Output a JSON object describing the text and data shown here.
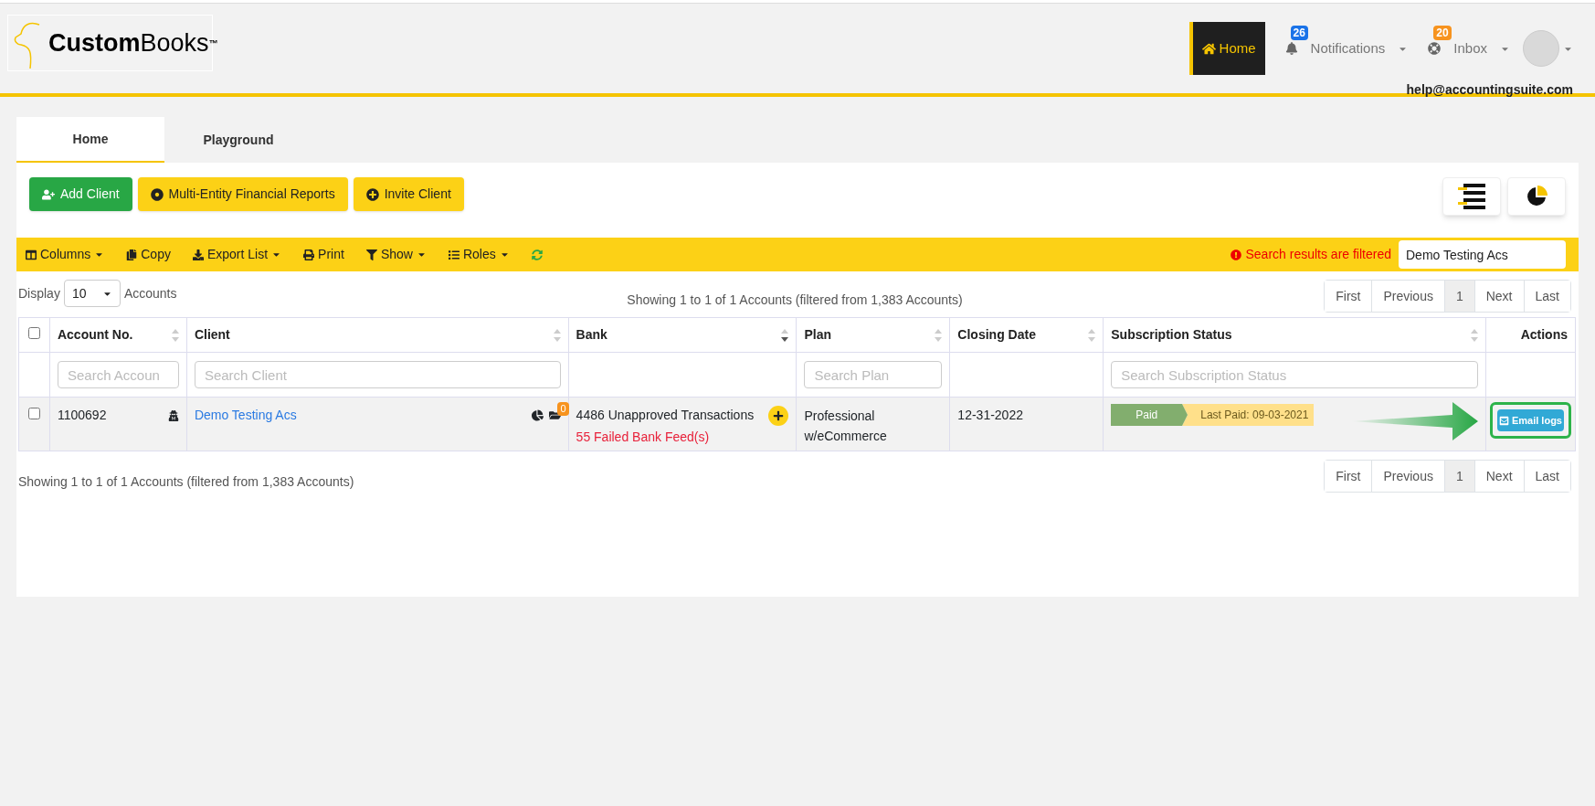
{
  "header": {
    "logo": {
      "bold": "Custom",
      "light": "Books",
      "mark": "™"
    },
    "nav": [
      {
        "kind": "home",
        "label": "Home",
        "selected": true
      },
      {
        "kind": "notifications",
        "label": "Notifications",
        "badge": "26"
      },
      {
        "kind": "inbox",
        "label": "Inbox",
        "badge": "20"
      }
    ],
    "user_email": "help@accountingsuite.com"
  },
  "tabs": [
    {
      "label": "Home",
      "selected": true
    },
    {
      "label": "Playground",
      "selected": false
    }
  ],
  "action_buttons": [
    {
      "kind": "add",
      "label": "Add Client",
      "color": "#28a745"
    },
    {
      "kind": "reports",
      "label": "Multi-Entity Financial Reports",
      "color": "#fcd116"
    },
    {
      "kind": "invite",
      "label": "Invite Client",
      "color": "#fcd116"
    }
  ],
  "toolbar": {
    "items": [
      {
        "kind": "columns",
        "label": "Columns",
        "dropdown": true
      },
      {
        "kind": "copy",
        "label": "Copy",
        "dropdown": false
      },
      {
        "kind": "export",
        "label": "Export List",
        "dropdown": true
      },
      {
        "kind": "print",
        "label": "Print",
        "dropdown": false
      },
      {
        "kind": "show",
        "label": "Show",
        "dropdown": true
      },
      {
        "kind": "roles",
        "label": "Roles",
        "dropdown": true
      }
    ],
    "filter_notice": "Search results are filtered",
    "search_value": "Demo Testing Acs"
  },
  "display": {
    "label": "Display",
    "value": "10",
    "suffix": "Accounts"
  },
  "info_top": "Showing 1 to 1 of 1 Accounts (filtered from 1,383 Accounts)",
  "pagination_top": [
    {
      "label": "First",
      "selected": false
    },
    {
      "label": "Previous",
      "selected": false
    },
    {
      "label": "1",
      "selected": true
    },
    {
      "label": "Next",
      "selected": false
    },
    {
      "label": "Last",
      "selected": false
    }
  ],
  "table": {
    "select_all": {
      "checked": false
    },
    "columns": [
      {
        "label": "Account No.",
        "sortable": true,
        "sorted": false,
        "placeholder": "Search Accoun"
      },
      {
        "label": "Client",
        "sortable": true,
        "sorted": false,
        "placeholder": "Search Client"
      },
      {
        "label": "Bank",
        "sortable": true,
        "sorted": true
      },
      {
        "label": "Plan",
        "sortable": true,
        "sorted": false,
        "placeholder": "Search Plan"
      },
      {
        "label": "Closing Date",
        "sortable": true,
        "sorted": false
      },
      {
        "label": "Subscription Status",
        "sortable": true,
        "sorted": false,
        "placeholder": "Search Subscription Status"
      },
      {
        "label": "Actions",
        "sortable": false
      }
    ],
    "rows": [
      {
        "checked": false,
        "account_no": "1100692",
        "client": "Demo Testing Acs",
        "client_badge": "0",
        "bank_info": "4486 Unapproved Transactions",
        "bank_alert": "55 Failed Bank Feed(s)",
        "plan": "Professional w/eCommerce",
        "closing_date": "12-31-2022",
        "status": "Paid",
        "last_paid": "Last Paid: 09-03-2021",
        "action": "Email logs",
        "highlighted": true
      }
    ]
  },
  "info_bottom": "Showing 1 to 1 of 1 Accounts (filtered from 1,383 Accounts)",
  "pagination_bottom": [
    {
      "label": "First",
      "selected": false
    },
    {
      "label": "Previous",
      "selected": false
    },
    {
      "label": "1",
      "selected": true
    },
    {
      "label": "Next",
      "selected": false
    },
    {
      "label": "Last",
      "selected": false
    }
  ]
}
